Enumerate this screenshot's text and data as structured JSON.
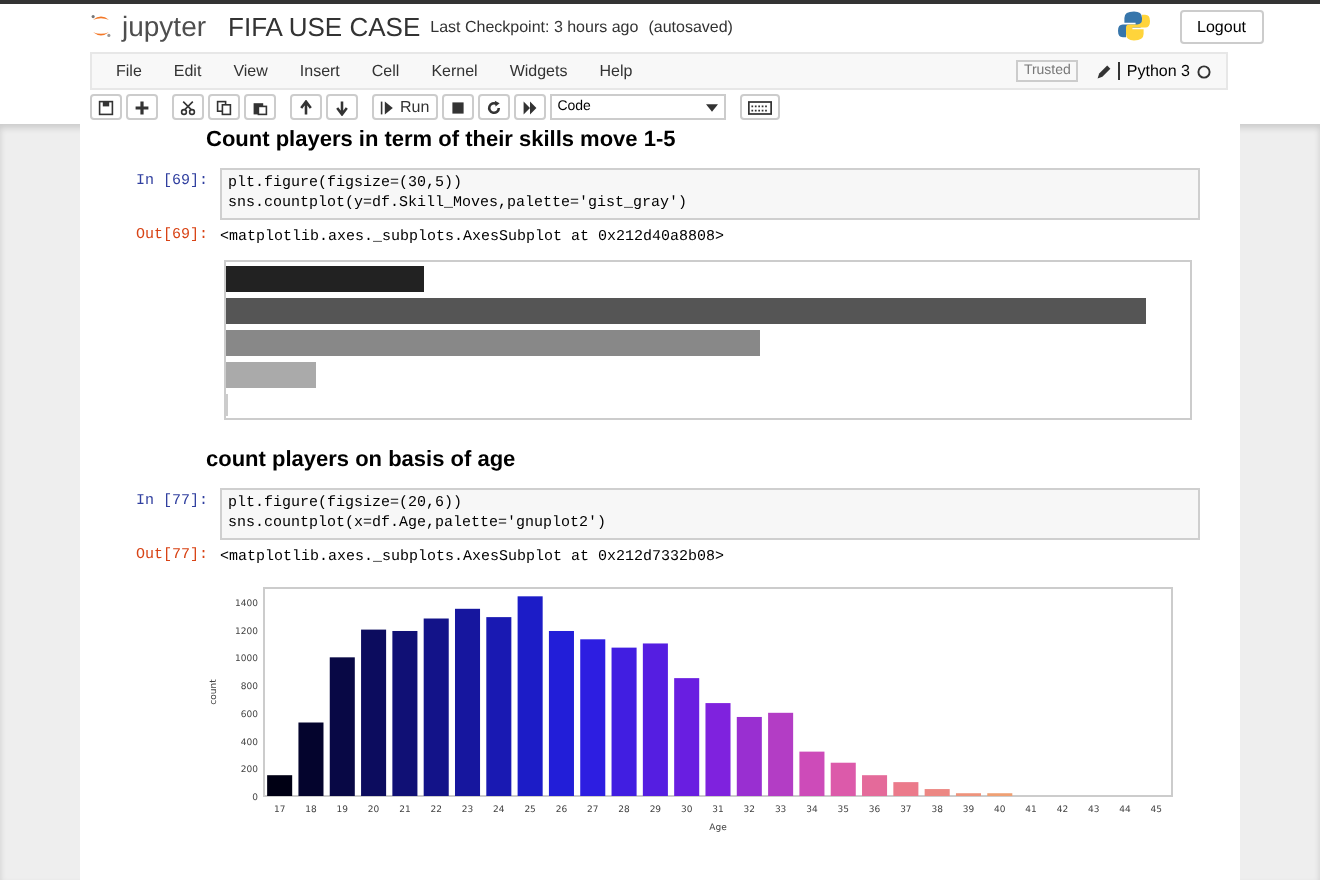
{
  "header": {
    "logo_text": "jupyter",
    "notebook_title": "FIFA USE CASE",
    "checkpoint": "Last Checkpoint: 3 hours ago",
    "autosave": "(autosaved)",
    "logout": "Logout"
  },
  "menu": [
    "File",
    "Edit",
    "View",
    "Insert",
    "Cell",
    "Kernel",
    "Widgets",
    "Help"
  ],
  "kernel": {
    "trusted": "Trusted",
    "name": "Python 3"
  },
  "toolbar": {
    "run": "Run",
    "cell_type": "Code"
  },
  "cells": [
    {
      "kind": "heading",
      "text": "Count players in term of their skills move 1-5"
    },
    {
      "kind": "code",
      "prompt": "In [69]:",
      "lines": [
        "plt.figure(figsize=(30,5))",
        "sns.countplot(y=df.Skill_Moves,palette='gist_gray')"
      ]
    },
    {
      "kind": "output",
      "prompt": "Out[69]:",
      "text": "<matplotlib.axes._subplots.AxesSubplot at 0x212d40a8808>"
    },
    {
      "kind": "hbar_figure"
    },
    {
      "kind": "heading",
      "text": "count players on basis of age"
    },
    {
      "kind": "code",
      "prompt": "In [77]:",
      "lines": [
        "plt.figure(figsize=(20,6))",
        "sns.countplot(x=df.Age,palette='gnuplot2')"
      ]
    },
    {
      "kind": "output",
      "prompt": "Out[77]:",
      "text": "<matplotlib.axes._subplots.AxesSubplot at 0x212d7332b08>"
    },
    {
      "kind": "chart",
      "chart_data": {
        "type": "bar",
        "xlabel": "Age",
        "ylabel": "count",
        "categories": [
          "17",
          "18",
          "19",
          "20",
          "21",
          "22",
          "23",
          "24",
          "25",
          "26",
          "27",
          "28",
          "29",
          "30",
          "31",
          "32",
          "33",
          "34",
          "35",
          "36",
          "37",
          "38",
          "39",
          "40",
          "41",
          "42",
          "43",
          "44",
          "45"
        ],
        "values": [
          150,
          530,
          1000,
          1200,
          1190,
          1280,
          1350,
          1290,
          1440,
          1190,
          1130,
          1070,
          1100,
          850,
          670,
          570,
          600,
          320,
          240,
          150,
          100,
          50,
          20,
          20,
          null,
          null,
          null,
          null,
          null
        ],
        "ylim": [
          0,
          1500
        ],
        "yticks": [
          0,
          200,
          400,
          600,
          800,
          1000,
          1200,
          1400
        ]
      }
    }
  ]
}
